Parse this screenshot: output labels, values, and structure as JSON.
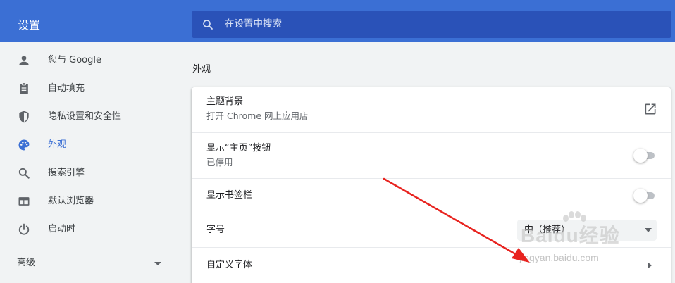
{
  "header": {
    "title": "设置",
    "search_placeholder": "在设置中搜索"
  },
  "sidebar": {
    "items": [
      {
        "label": "您与 Google",
        "icon": "person-icon",
        "active": false
      },
      {
        "label": "自动填充",
        "icon": "clipboard-icon",
        "active": false
      },
      {
        "label": "隐私设置和安全性",
        "icon": "shield-icon",
        "active": false
      },
      {
        "label": "外观",
        "icon": "palette-icon",
        "active": true
      },
      {
        "label": "搜索引擎",
        "icon": "search-icon",
        "active": false
      },
      {
        "label": "默认浏览器",
        "icon": "browser-icon",
        "active": false
      },
      {
        "label": "启动时",
        "icon": "power-icon",
        "active": false
      }
    ],
    "advanced_label": "高级"
  },
  "main": {
    "section_title": "外观",
    "rows": [
      {
        "title": "主题背景",
        "subtitle": "打开 Chrome 网上应用店",
        "control": "external-link"
      },
      {
        "title": "显示“主页”按钮",
        "subtitle": "已停用",
        "control": "toggle",
        "on": false
      },
      {
        "title": "显示书签栏",
        "control": "toggle",
        "on": false
      },
      {
        "title": "字号",
        "control": "select",
        "value": "中（推荐）"
      },
      {
        "title": "自定义字体",
        "control": "chevron"
      }
    ]
  },
  "watermark": {
    "brand": "Baidu经验",
    "url": "jingyan.baidu.com"
  },
  "colors": {
    "header_bg": "#3b6fd4",
    "search_bg": "#2a52b8",
    "accent": "#3b6fd4",
    "annotation_arrow": "#e8231f"
  }
}
